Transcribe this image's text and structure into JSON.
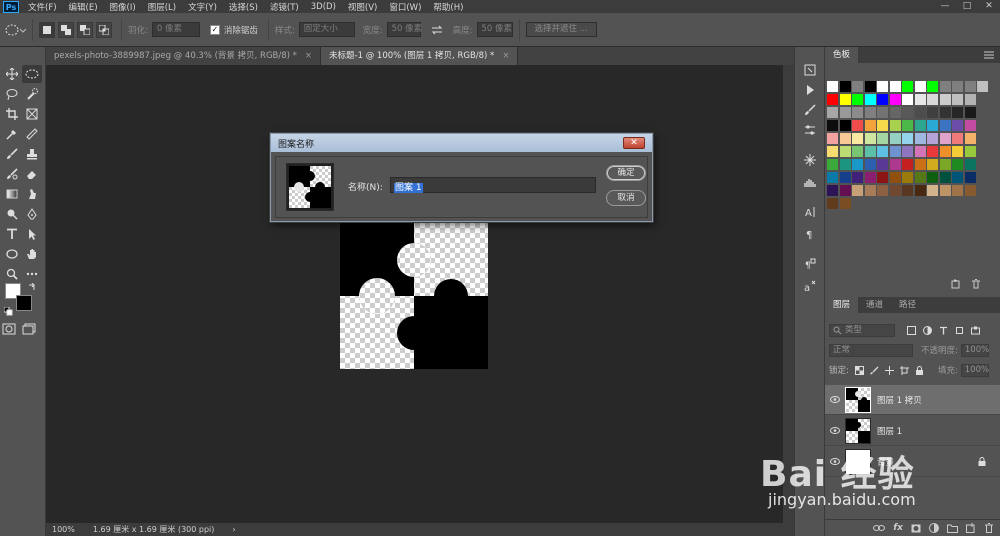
{
  "app": {
    "logo": "Ps"
  },
  "menu": [
    "文件(F)",
    "编辑(E)",
    "图像(I)",
    "图层(L)",
    "文字(Y)",
    "选择(S)",
    "滤镜(T)",
    "3D(D)",
    "视图(V)",
    "窗口(W)",
    "帮助(H)"
  ],
  "window_controls": [
    "—",
    "□",
    "✕"
  ],
  "options": {
    "feather_label": "羽化:",
    "feather_value": "0 像素",
    "antialias_label": "消除锯齿",
    "style_label": "样式:",
    "style_value": "固定大小",
    "width_label": "宽度:",
    "width_value": "50 像素",
    "height_label": "高度:",
    "height_value": "50 像素",
    "select_mask": "选择并遮住 ..."
  },
  "tabs": [
    {
      "label": "pexels-photo-3889987.jpeg @ 40.3% (背景 拷贝, RGB/8) *",
      "close": "×"
    },
    {
      "label": "未标题-1 @ 100% (图层 1 拷贝, RGB/8) *",
      "close": "×"
    }
  ],
  "status": {
    "zoom": "100%",
    "info": "1.69 厘米 x 1.69 厘米 (300 ppi)",
    "arrow": "›"
  },
  "dialog": {
    "title": "图案名称",
    "close": "✕",
    "name_label": "名称(N):",
    "name_value": "图案 1",
    "ok": "确定",
    "cancel": "取消"
  },
  "swatches_panel": {
    "tab": "色板"
  },
  "layers_panel": {
    "tabs": [
      "图层",
      "通道",
      "路径"
    ],
    "kind_placeholder": "类型",
    "blend_mode": "正常",
    "opacity_label": "不透明度:",
    "opacity_value": "100%",
    "lock_label": "锁定:",
    "fill_label": "填充:",
    "fill_value": "100%",
    "layers": [
      {
        "name": "图层 1 拷贝",
        "selected": true
      },
      {
        "name": "图层 1",
        "selected": false
      },
      {
        "name": "背景",
        "selected": false
      }
    ],
    "bottom_icons": [
      "link-icon",
      "fx-icon",
      "mask-icon",
      "adjustment-icon",
      "group-icon",
      "new-layer-icon",
      "trash-icon"
    ],
    "bottom_fx": "fx"
  },
  "watermark": {
    "text": "Bai 经验",
    "url": "jingyan.baidu.com"
  },
  "colors": {
    "selection": "#3372d4",
    "dialog_title": "#b8c8de"
  }
}
